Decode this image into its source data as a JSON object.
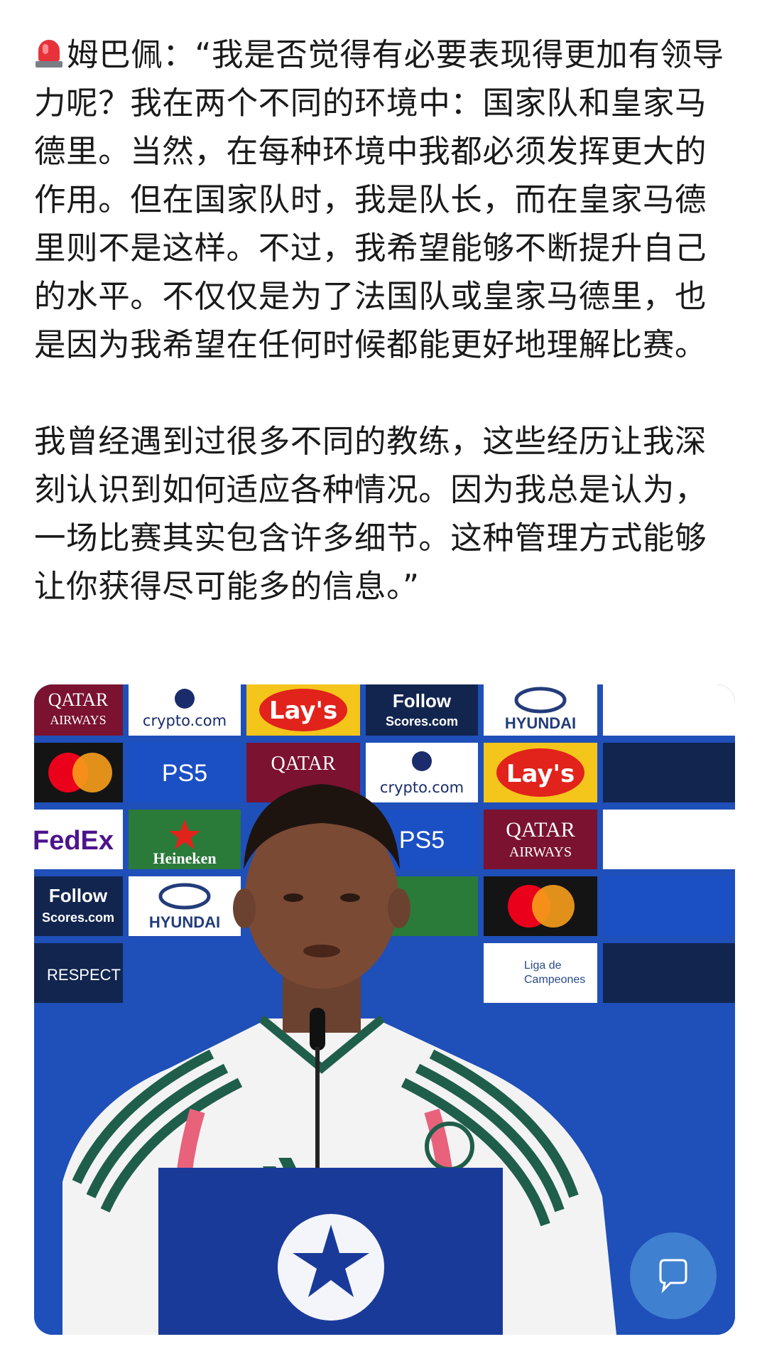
{
  "post": {
    "paragraphs": [
      "姆巴佩：“我是否觉得有必要表现得更加有领导力呢？我在两个不同的环境中：国家队和皇家马德里。当然，在每种环境中我都必须发挥更大的作用。但在国家队时，我是队长，而在皇家马德里则不是这样。不过，我希望能够不断提升自己的水平。不仅仅是为了法国队或皇家马德里，也是因为我希望在任何时候都能更好地理解比赛。",
      "我曾经遇到过很多不同的教练，这些经历让我深刻认识到如何适应各种情况。因为我总是认为，一场比赛其实包含许多细节。这种管理方式能够让你获得尽可能多的信息。”"
    ],
    "lead_icon": "siren-icon"
  },
  "photo": {
    "sponsor_boards": {
      "qatar_airways": [
        "QATAR",
        "AIRWAYS"
      ],
      "crypto": "crypto.com",
      "lays": "Lay's",
      "follow_scores": [
        "Follow",
        "Scores.com"
      ],
      "hyundai": "HYUNDAI",
      "ps5": "PS5",
      "fedex": "FedEx",
      "heineken": "Heineken",
      "respect": "RESPECT",
      "liga": [
        "Liga de",
        "Campeones"
      ]
    },
    "overlay_icon": "chat-bubble-icon"
  }
}
